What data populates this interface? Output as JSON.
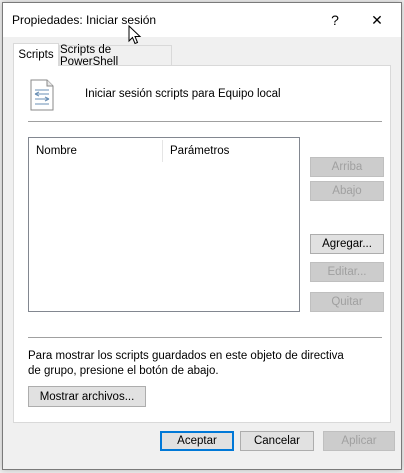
{
  "window": {
    "title": "Propiedades: Iniciar sesión",
    "help_label": "?",
    "close_label": "✕"
  },
  "tabs": [
    {
      "label": "Scripts",
      "active": true
    },
    {
      "label": "Scripts de PowerShell",
      "active": false
    }
  ],
  "panel": {
    "header_label": "Iniciar sesión scripts para Equipo local",
    "list": {
      "columns": [
        "Nombre",
        "Parámetros"
      ],
      "rows": []
    },
    "side_buttons": {
      "up": "Arriba",
      "down": "Abajo",
      "add": "Agregar...",
      "edit": "Editar...",
      "remove": "Quitar"
    },
    "info_text": "Para mostrar los scripts guardados en este objeto de directiva de grupo, presione el botón de abajo.",
    "show_files_label": "Mostrar archivos..."
  },
  "footer": {
    "ok_label": "Aceptar",
    "cancel_label": "Cancelar",
    "apply_label": "Aplicar"
  },
  "icons": {
    "script": "script-document-icon",
    "cursor": "mouse-pointer-icon"
  },
  "colors": {
    "accent": "#0078d7",
    "dialog_bg": "#f0f0f0",
    "panel_bg": "#ffffff",
    "disabled_text": "#a0a0a0"
  }
}
